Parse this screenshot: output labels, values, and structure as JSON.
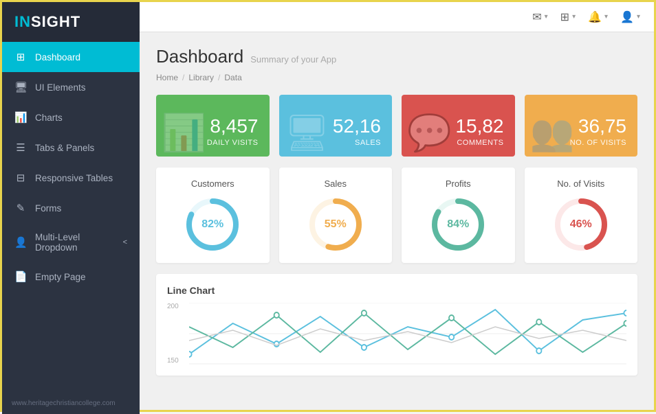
{
  "app": {
    "logo_in": "IN",
    "logo_sight": "SIGHT"
  },
  "sidebar": {
    "items": [
      {
        "id": "dashboard",
        "label": "Dashboard",
        "icon": "⊞",
        "active": true
      },
      {
        "id": "ui-elements",
        "label": "UI Elements",
        "icon": "🖥",
        "active": false
      },
      {
        "id": "charts",
        "label": "Charts",
        "icon": "📊",
        "active": false
      },
      {
        "id": "tabs-panels",
        "label": "Tabs & Panels",
        "icon": "☰",
        "active": false
      },
      {
        "id": "responsive-tables",
        "label": "Responsive Tables",
        "icon": "⊟",
        "active": false
      },
      {
        "id": "forms",
        "label": "Forms",
        "icon": "✎",
        "active": false
      },
      {
        "id": "multi-level-dropdown",
        "label": "Multi-Level Dropdown",
        "icon": "👤",
        "active": false,
        "arrow": "<"
      },
      {
        "id": "empty-page",
        "label": "Empty Page",
        "icon": "📄",
        "active": false
      }
    ],
    "footer": "www.heritagechristiancollege.com"
  },
  "topbar": {
    "icons": [
      {
        "id": "mail",
        "symbol": "✉",
        "caret": "▾"
      },
      {
        "id": "grid",
        "symbol": "⊞",
        "caret": "▾"
      },
      {
        "id": "bell",
        "symbol": "🔔",
        "caret": "▾"
      },
      {
        "id": "user",
        "symbol": "👤",
        "caret": "▾"
      }
    ]
  },
  "page": {
    "title": "Dashboard",
    "subtitle": "Summary of your App",
    "breadcrumb": [
      "Home",
      "Library",
      "Data"
    ]
  },
  "stat_cards": [
    {
      "id": "daily-visits",
      "value": "8,457",
      "label": "Daily Visits",
      "color": "green",
      "bg_icon": "📊"
    },
    {
      "id": "sales",
      "value": "52,16",
      "label": "Sales",
      "color": "cyan",
      "bg_icon": "🖥"
    },
    {
      "id": "comments",
      "value": "15,82",
      "label": "Comments",
      "color": "red",
      "bg_icon": "💬"
    },
    {
      "id": "no-of-visits",
      "value": "36,75",
      "label": "No. of Visits",
      "color": "orange",
      "bg_icon": "👥"
    }
  ],
  "donut_panels": [
    {
      "id": "customers",
      "title": "Customers",
      "percent": 82,
      "label": "82%",
      "color": "#5bc0de",
      "track": "#e8f7fb"
    },
    {
      "id": "sales",
      "title": "Sales",
      "percent": 55,
      "label": "55%",
      "color": "#f0ad4e",
      "track": "#fdf3e3"
    },
    {
      "id": "profits",
      "title": "Profits",
      "percent": 84,
      "label": "84%",
      "color": "#5cb8a0",
      "track": "#e8f7f3"
    },
    {
      "id": "no-of-visits",
      "title": "No. of Visits",
      "percent": 46,
      "label": "46%",
      "color": "#d9534f",
      "track": "#fce8e8"
    }
  ],
  "line_chart": {
    "title": "Line Chart",
    "y_labels": [
      "200",
      "150"
    ],
    "series": [
      {
        "id": "series1",
        "color": "#5bc0de",
        "points": [
          10,
          60,
          30,
          70,
          20,
          50,
          40,
          80,
          15,
          65
        ]
      },
      {
        "id": "series2",
        "color": "#5cb8a0",
        "points": [
          50,
          20,
          65,
          15,
          70,
          25,
          60,
          10,
          55,
          20
        ]
      },
      {
        "id": "series3",
        "color": "#aaa",
        "points": [
          30,
          45,
          20,
          50,
          35,
          45,
          25,
          55,
          30,
          50
        ]
      }
    ]
  }
}
